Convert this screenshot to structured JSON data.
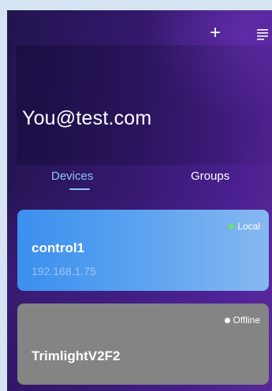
{
  "header": {
    "add_icon": "plus-icon",
    "menu_icon": "menu-lines-icon",
    "user_email": "You@test.com"
  },
  "tabs": [
    {
      "label": "Devices",
      "active": true
    },
    {
      "label": "Groups",
      "active": false
    }
  ],
  "devices": [
    {
      "name": "control1",
      "ip": "192.168.1.75",
      "status": "Local",
      "status_color": "#6de06d"
    },
    {
      "name": "TrimlightV2F2",
      "status": "Offline",
      "status_color": "#ffffff"
    }
  ],
  "colors": {
    "accent": "#8fc4f5",
    "local_card": "#3b8fee",
    "offline_card": "#848484"
  }
}
